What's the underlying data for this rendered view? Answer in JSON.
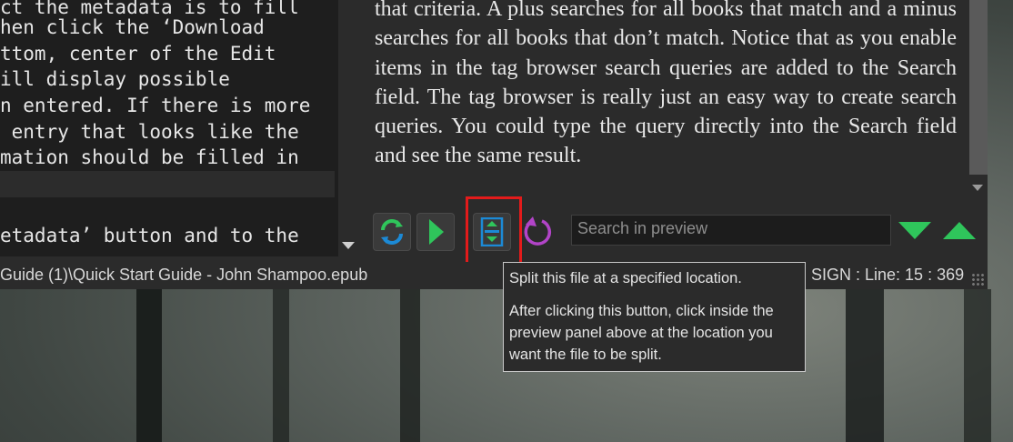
{
  "code_pane": {
    "lines": [
      "ct the metadata is to fill",
      "hen click the ‘Download",
      "ttom, center of the Edit",
      "ill display possible",
      "n entered. If there is more",
      " entry that looks like the",
      "mation should be filled in",
      "",
      "",
      "etadata’ button and to the",
      "                    .. ."
    ]
  },
  "preview": {
    "text": "that criteria. A plus searches for all books that match and a minus searches for all books that don’t match. Notice that as you enable items in the tag browser search queries are added to the Search field. The tag browser is really just an easy way to create search queries. You could type the query directly into the Search field and see the same result."
  },
  "toolbar": {
    "refresh_icon": "refresh-icon",
    "play_icon": "play-icon",
    "split_icon": "split-file-icon",
    "redo_icon": "circular-arrow-icon",
    "search_placeholder": "Search in preview",
    "next_icon": "triangle-down-icon",
    "prev_icon": "triangle-up-icon"
  },
  "statusbar": {
    "path": "Guide (1)\\Quick Start Guide - John Shampoo.epub",
    "position": "SIGN : Line: 15 : 369"
  },
  "tooltip": {
    "title": "Split this file at a specified location.",
    "body": "After clicking this button, click inside the preview panel above at the location you want the file to be split."
  },
  "colors": {
    "highlight": "#e31b1b",
    "accent_green": "#2fc55b",
    "accent_blue": "#1c8ad6",
    "accent_purple": "#b244c8"
  }
}
